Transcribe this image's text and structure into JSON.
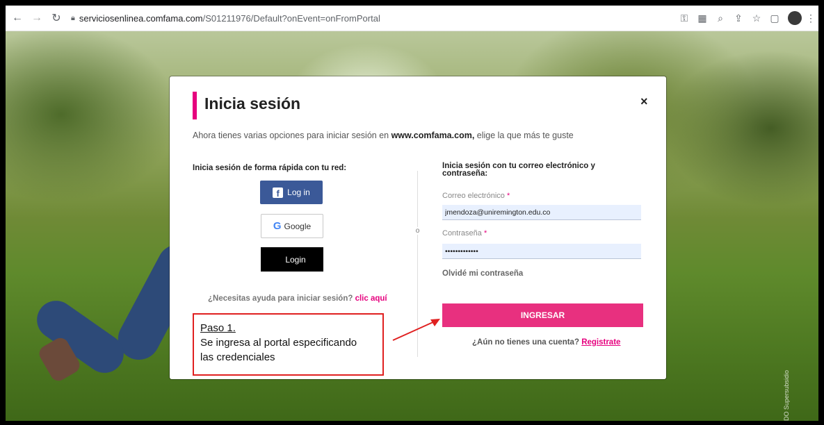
{
  "browser": {
    "url_host": "serviciosenlinea.comfama.com",
    "url_path": "/S01211976/Default?onEvent=onFromPortal"
  },
  "modal": {
    "title": "Inicia sesión",
    "close_label": "×",
    "subtitle_prefix": "Ahora tienes varias opciones para iniciar sesión en ",
    "subtitle_domain": "www.comfama.com,",
    "subtitle_suffix": " elige la que más te guste",
    "left_heading": "Inicia sesión de forma rápida con tu red:",
    "facebook_label": "Log in",
    "google_label": "Google",
    "apple_label": "Login",
    "help_text": "¿Necesitas ayuda para iniciar sesión?",
    "help_link": "clic aquí",
    "or_label": "o",
    "right_heading": "Inicia sesión con tu correo electrónico y contraseña:",
    "email_label": "Correo electrónico",
    "email_value": "jmendoza@uniremington.edu.co",
    "password_label": "Contraseña",
    "password_value": "•••••••••••••",
    "required_mark": "*",
    "forgot_label": "Olvidé mi contraseña",
    "submit_label": "INGRESAR",
    "no_account_text": "¿Aún no tienes una cuenta?",
    "register_link": "Registrate"
  },
  "annotation": {
    "step": "Paso 1.",
    "line1": "Se ingresa al portal especificando",
    "line2": "las credenciales"
  },
  "side_watermark": "VIGILADO Supersubsidio",
  "colors": {
    "accent": "#e6007e",
    "submit": "#e8307f",
    "facebook": "#3b5998",
    "annotation_border": "#e02020"
  }
}
